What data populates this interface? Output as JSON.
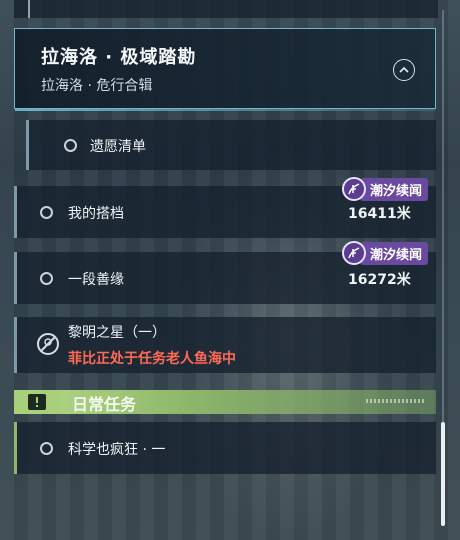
{
  "header": {
    "title": "拉海洛 · 极域踏勘",
    "subtitle": "拉海洛 · 危行合辑"
  },
  "quests": [
    {
      "label": "遗愿清单"
    },
    {
      "label": "我的搭档",
      "badge": "潮汐续闻",
      "distance": "16411米"
    },
    {
      "label": "一段善缘",
      "badge": "潮汐续闻",
      "distance": "16272米"
    },
    {
      "label": "黎明之星（一）",
      "warning": "菲比正处于任务老人鱼海中"
    }
  ],
  "daily": {
    "title": "日常任务",
    "items": [
      {
        "label": "科学也疯狂 · 一"
      }
    ]
  },
  "colors": {
    "accent": "#6fb6c6",
    "badge": "#6a4aa0",
    "warning": "#ff6a55",
    "daily": "#a7cf7c"
  }
}
